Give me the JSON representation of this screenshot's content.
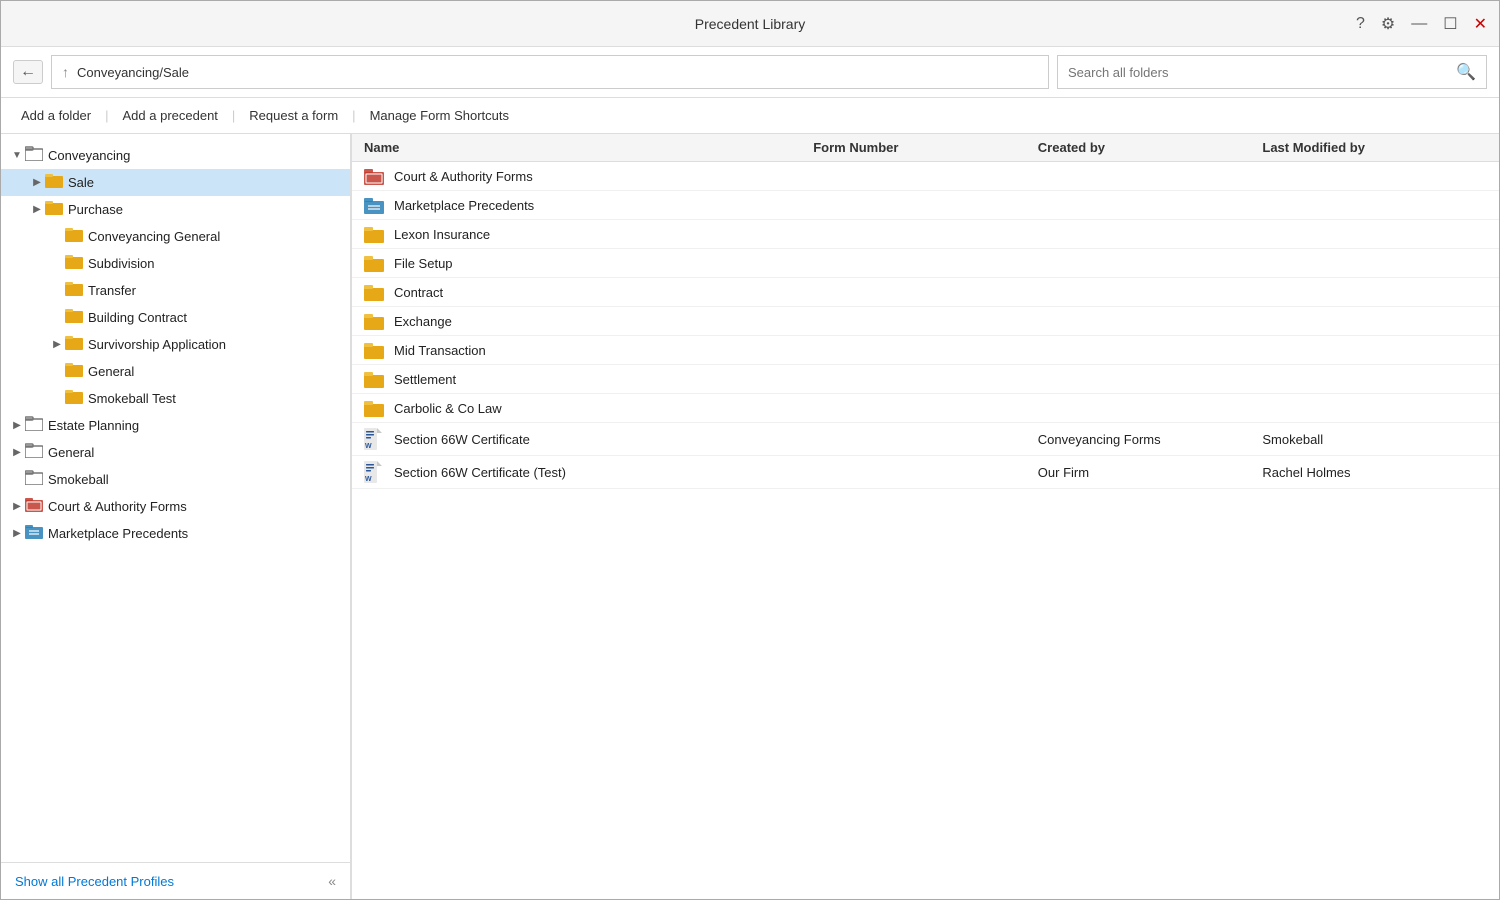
{
  "window": {
    "title": "Precedent Library"
  },
  "titlebar": {
    "help_icon": "?",
    "settings_icon": "⚙",
    "minimize_icon": "—",
    "maximize_icon": "☐",
    "close_icon": "✕"
  },
  "nav": {
    "back_icon": "←",
    "up_icon": "↑",
    "path": "Conveyancing/Sale",
    "search_placeholder": "Search all folders"
  },
  "toolbar": {
    "add_folder": "Add a folder",
    "add_precedent": "Add a precedent",
    "request_form": "Request a form",
    "manage_shortcuts": "Manage Form Shortcuts"
  },
  "columns": {
    "name": "Name",
    "form_number": "Form Number",
    "created_by": "Created by",
    "last_modified_by": "Last Modified by"
  },
  "sidebar": {
    "footer_link": "Show all Precedent Profiles",
    "collapse_icon": "«",
    "items": [
      {
        "id": "conveyancing",
        "label": "Conveyancing",
        "indent": 0,
        "toggle": "▼",
        "icon_type": "folder-outline",
        "icon": "📁",
        "selected": false
      },
      {
        "id": "sale",
        "label": "Sale",
        "indent": 1,
        "toggle": "▶",
        "icon_type": "folder-yellow",
        "icon": "📁",
        "selected": true
      },
      {
        "id": "purchase",
        "label": "Purchase",
        "indent": 1,
        "toggle": "▶",
        "icon_type": "folder-yellow",
        "icon": "📁",
        "selected": false
      },
      {
        "id": "conveyancing-general",
        "label": "Conveyancing General",
        "indent": 2,
        "toggle": "",
        "icon_type": "folder-yellow",
        "icon": "📁",
        "selected": false
      },
      {
        "id": "subdivision",
        "label": "Subdivision",
        "indent": 2,
        "toggle": "",
        "icon_type": "folder-yellow",
        "icon": "📁",
        "selected": false
      },
      {
        "id": "transfer",
        "label": "Transfer",
        "indent": 2,
        "toggle": "",
        "icon_type": "folder-yellow",
        "icon": "📁",
        "selected": false
      },
      {
        "id": "building-contract",
        "label": "Building Contract",
        "indent": 2,
        "toggle": "",
        "icon_type": "folder-yellow",
        "icon": "📁",
        "selected": false
      },
      {
        "id": "survivorship-application",
        "label": "Survivorship Application",
        "indent": 2,
        "toggle": "▶",
        "icon_type": "folder-yellow",
        "icon": "📁",
        "selected": false
      },
      {
        "id": "general",
        "label": "General",
        "indent": 2,
        "toggle": "",
        "icon_type": "folder-yellow",
        "icon": "📁",
        "selected": false
      },
      {
        "id": "smokeball-test",
        "label": "Smokeball Test",
        "indent": 2,
        "toggle": "",
        "icon_type": "folder-yellow",
        "icon": "📁",
        "selected": false
      },
      {
        "id": "estate-planning",
        "label": "Estate Planning",
        "indent": 0,
        "toggle": "▶",
        "icon_type": "folder-outline",
        "icon": "📁",
        "selected": false
      },
      {
        "id": "general-top",
        "label": "General",
        "indent": 0,
        "toggle": "▶",
        "icon_type": "folder-outline",
        "icon": "📁",
        "selected": false
      },
      {
        "id": "smokeball",
        "label": "Smokeball",
        "indent": 0,
        "toggle": "",
        "icon_type": "folder-outline",
        "icon": "📁",
        "selected": false
      },
      {
        "id": "court-authority-forms",
        "label": "Court & Authority Forms",
        "indent": 0,
        "toggle": "▶",
        "icon_type": "folder-red",
        "icon": "🏛",
        "selected": false
      },
      {
        "id": "marketplace-precedents",
        "label": "Marketplace Precedents",
        "indent": 0,
        "toggle": "▶",
        "icon_type": "folder-blue",
        "icon": "📊",
        "selected": false
      }
    ]
  },
  "files": [
    {
      "id": "f1",
      "name": "Court & Authority Forms",
      "icon_type": "folder-red",
      "icon": "🏛",
      "form_number": "",
      "created_by": "",
      "last_modified_by": ""
    },
    {
      "id": "f2",
      "name": "Marketplace Precedents",
      "icon_type": "folder-blue",
      "icon": "📊",
      "form_number": "",
      "created_by": "",
      "last_modified_by": ""
    },
    {
      "id": "f3",
      "name": "Lexon Insurance",
      "icon_type": "folder",
      "icon": "📁",
      "form_number": "",
      "created_by": "",
      "last_modified_by": ""
    },
    {
      "id": "f4",
      "name": "File Setup",
      "icon_type": "folder",
      "icon": "📁",
      "form_number": "",
      "created_by": "",
      "last_modified_by": ""
    },
    {
      "id": "f5",
      "name": "Contract",
      "icon_type": "folder",
      "icon": "📁",
      "form_number": "",
      "created_by": "",
      "last_modified_by": ""
    },
    {
      "id": "f6",
      "name": "Exchange",
      "icon_type": "folder",
      "icon": "📁",
      "form_number": "",
      "created_by": "",
      "last_modified_by": ""
    },
    {
      "id": "f7",
      "name": "Mid Transaction",
      "icon_type": "folder",
      "icon": "📁",
      "form_number": "",
      "created_by": "",
      "last_modified_by": ""
    },
    {
      "id": "f8",
      "name": "Settlement",
      "icon_type": "folder",
      "icon": "📁",
      "form_number": "",
      "created_by": "",
      "last_modified_by": ""
    },
    {
      "id": "f9",
      "name": "Carbolic & Co Law",
      "icon_type": "folder",
      "icon": "📁",
      "form_number": "",
      "created_by": "",
      "last_modified_by": ""
    },
    {
      "id": "f10",
      "name": "Section 66W Certificate",
      "icon_type": "word",
      "icon": "W",
      "form_number": "",
      "created_by": "Conveyancing Forms",
      "last_modified_by": "Smokeball"
    },
    {
      "id": "f11",
      "name": "Section 66W Certificate (Test)",
      "icon_type": "word",
      "icon": "W",
      "form_number": "",
      "created_by": "Our Firm",
      "last_modified_by": "Rachel Holmes"
    }
  ]
}
